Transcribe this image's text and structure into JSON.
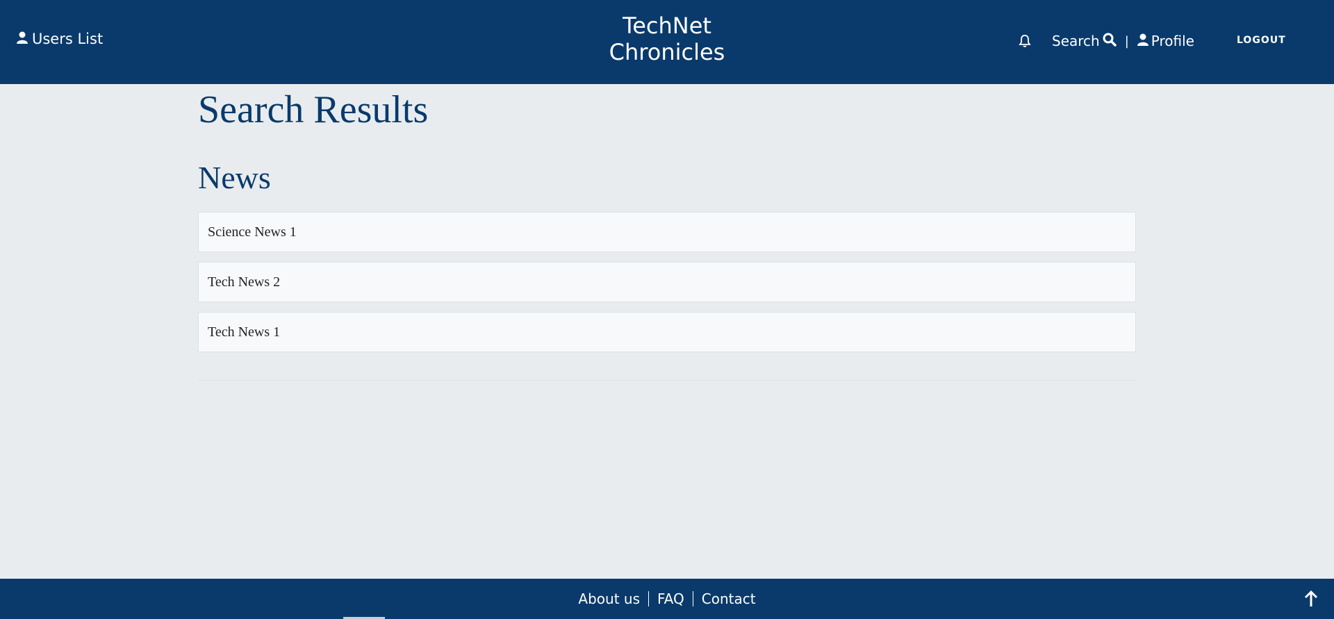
{
  "header": {
    "users_link": "Users List",
    "brand_line1": "TechNet",
    "brand_line2": "Chronicles",
    "search_label": "Search",
    "separator": "|",
    "profile_label": "Profile",
    "logout_label": "LOGOUT"
  },
  "main": {
    "page_title": "Search Results",
    "section_title": "News",
    "results": [
      {
        "title": "Science News 1"
      },
      {
        "title": "Tech News 2"
      },
      {
        "title": "Tech News 1"
      }
    ]
  },
  "footer": {
    "links": [
      {
        "label": "About us"
      },
      {
        "label": "FAQ"
      },
      {
        "label": "Contact"
      }
    ]
  },
  "colors": {
    "primary": "#0a3a6b",
    "background": "#e8ecef",
    "card": "#f8f9fb"
  },
  "icons": {
    "users": "user-icon",
    "bell": "bell-icon",
    "search": "search-icon",
    "profile": "user-icon",
    "back_to_top": "arrow-up-icon"
  }
}
